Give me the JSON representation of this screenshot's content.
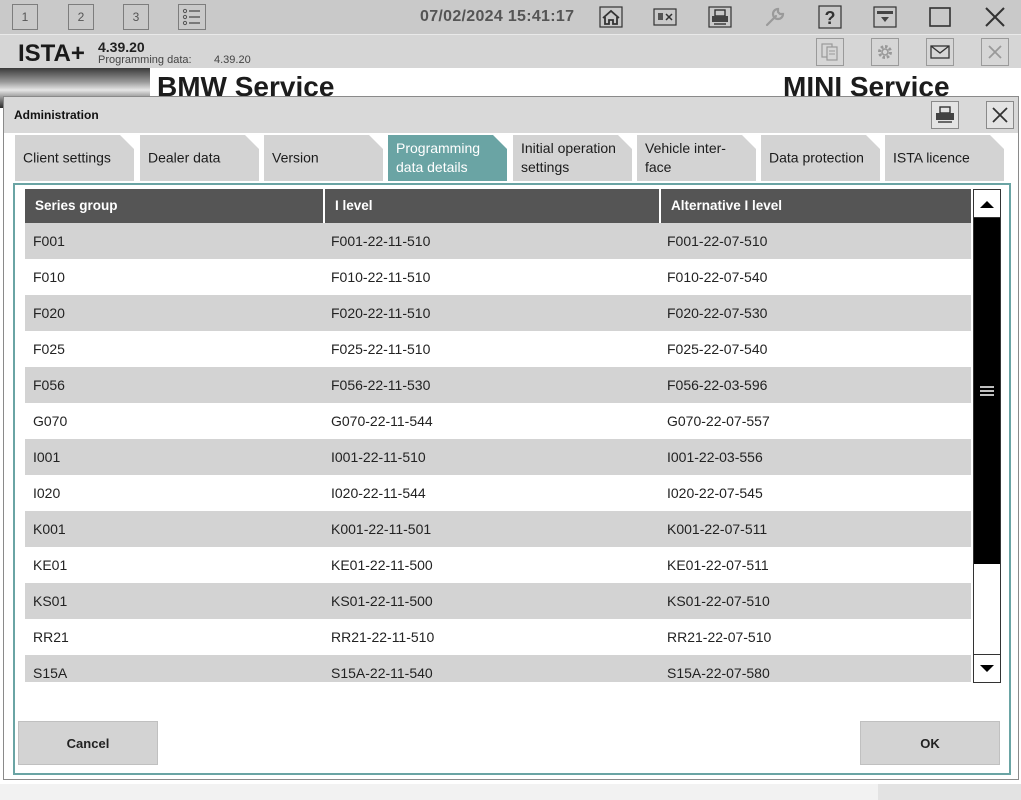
{
  "topbar": {
    "tab_buttons": [
      "1",
      "2",
      "3"
    ],
    "datetime": "07/02/2024 15:41:17"
  },
  "appbar": {
    "name": "ISTA+",
    "version": "4.39.20",
    "programming_label": "Programming data:",
    "programming_version": "4.39.20"
  },
  "brand": {
    "bmw": "BMW Service",
    "mini": "MINI Service"
  },
  "dialog": {
    "title": "Administration",
    "tabs": [
      {
        "label": "Client settings"
      },
      {
        "label": "Dealer data"
      },
      {
        "label": "Version"
      },
      {
        "label": "Programming data details",
        "active": true
      },
      {
        "label": "Initial operation settings"
      },
      {
        "label": "Vehicle inter-face"
      },
      {
        "label": "Data protection"
      },
      {
        "label": "ISTA licence"
      }
    ],
    "table": {
      "columns": [
        "Series group",
        "I level",
        "Alternative I level"
      ],
      "rows": [
        [
          "F001",
          "F001-22-11-510",
          "F001-22-07-510"
        ],
        [
          "F010",
          "F010-22-11-510",
          "F010-22-07-540"
        ],
        [
          "F020",
          "F020-22-11-510",
          "F020-22-07-530"
        ],
        [
          "F025",
          "F025-22-11-510",
          "F025-22-07-540"
        ],
        [
          "F056",
          "F056-22-11-530",
          "F056-22-03-596"
        ],
        [
          "G070",
          "G070-22-11-544",
          "G070-22-07-557"
        ],
        [
          "I001",
          "I001-22-11-510",
          "I001-22-03-556"
        ],
        [
          "I020",
          "I020-22-11-544",
          "I020-22-07-545"
        ],
        [
          "K001",
          "K001-22-11-501",
          "K001-22-07-511"
        ],
        [
          "KE01",
          "KE01-22-11-500",
          "KE01-22-07-511"
        ],
        [
          "KS01",
          "KS01-22-11-500",
          "KS01-22-07-510"
        ],
        [
          "RR21",
          "RR21-22-11-510",
          "RR21-22-07-510"
        ],
        [
          "S15A",
          "S15A-22-11-540",
          "S15A-22-07-580"
        ]
      ]
    },
    "cancel_label": "Cancel",
    "ok_label": "OK"
  },
  "colors": {
    "accent": "#6aa4a4",
    "header_dark": "#555555",
    "row_alt": "#d3d3d3",
    "toolbar": "#c9c9c9"
  }
}
